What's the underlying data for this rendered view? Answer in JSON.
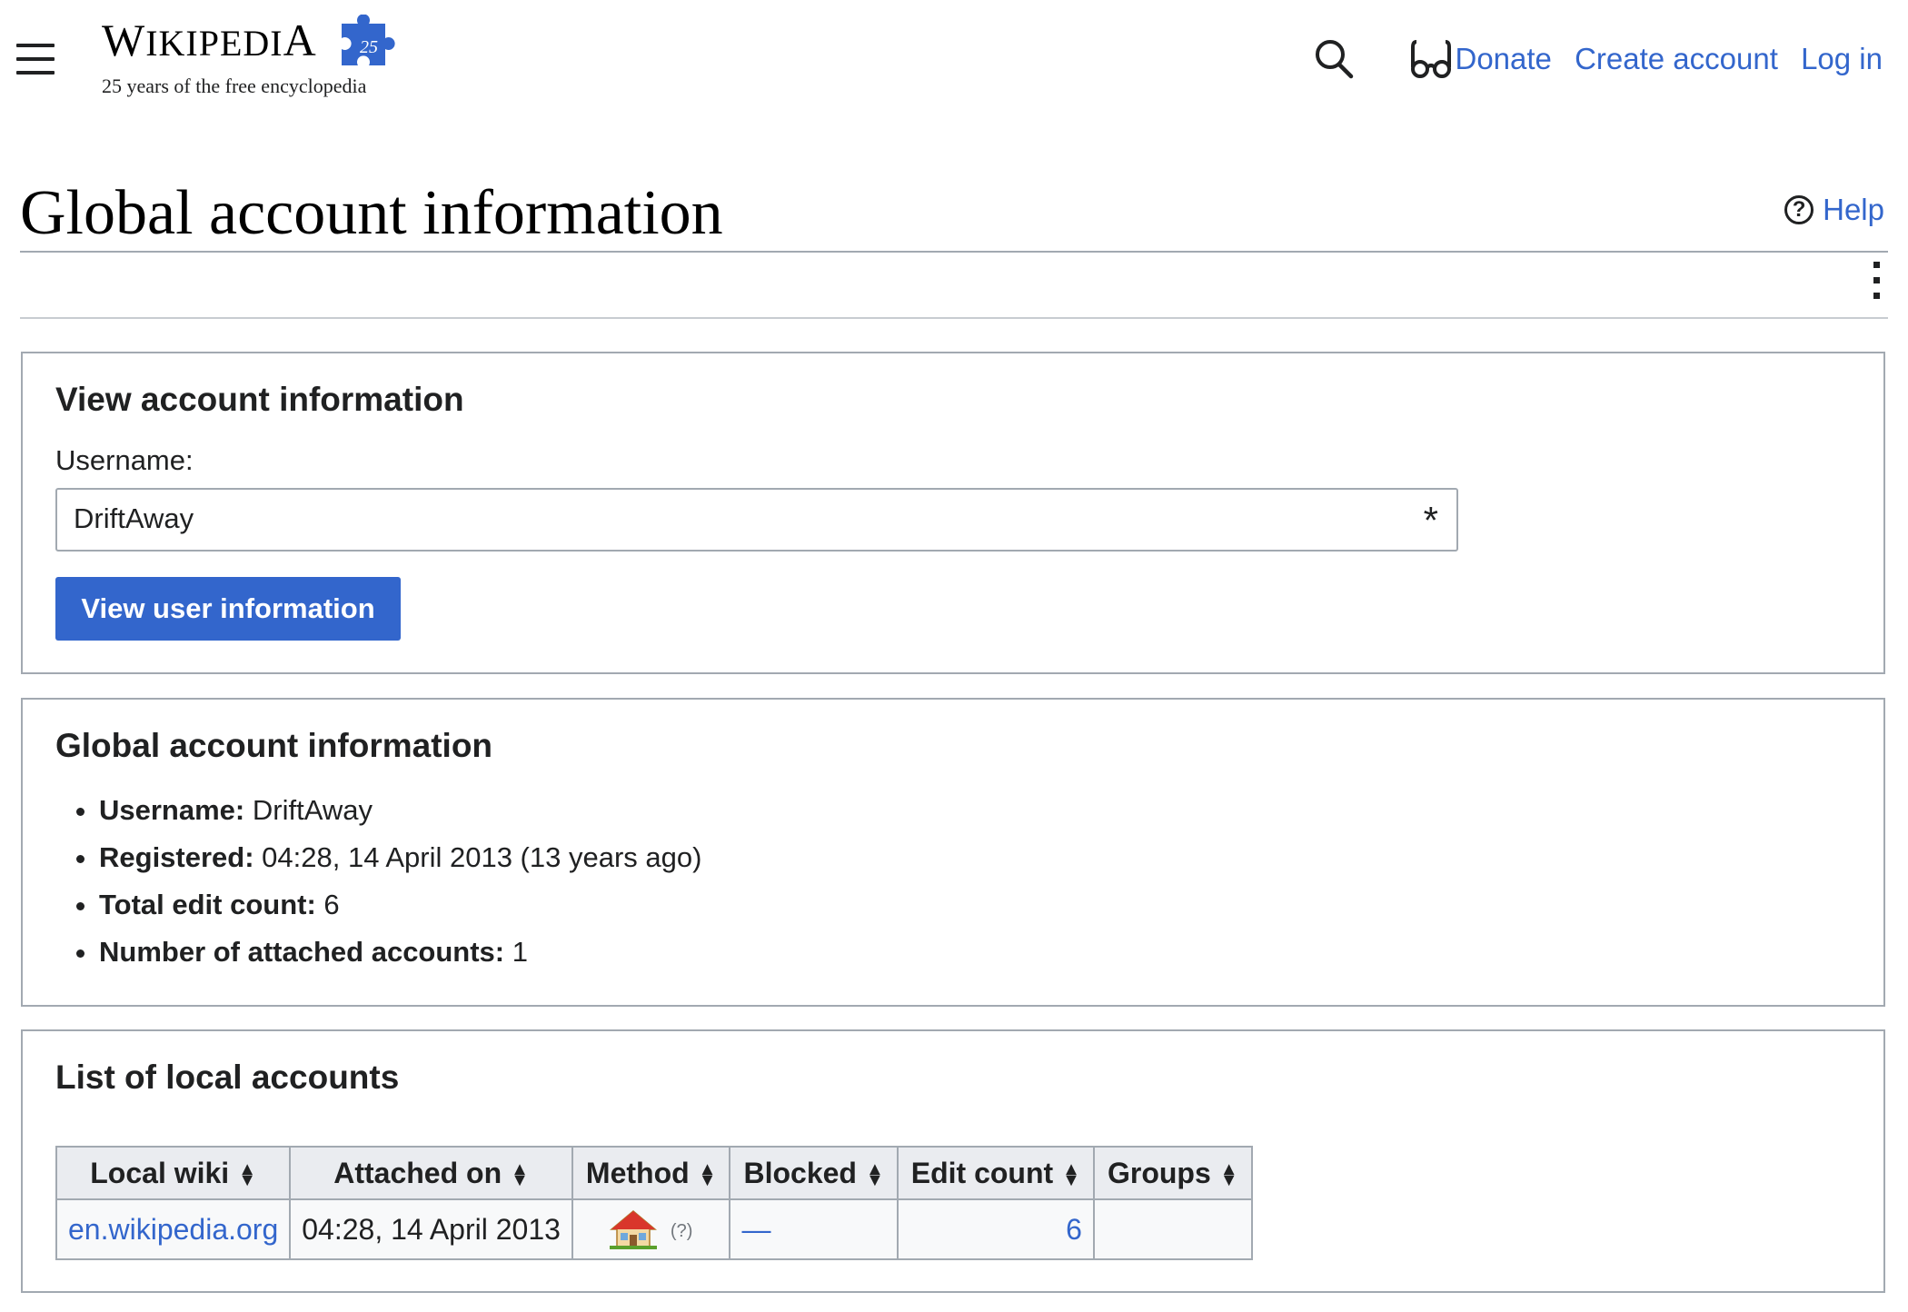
{
  "header": {
    "wordmark_first": "W",
    "wordmark_rest": "IKIPEDI",
    "wordmark_last": "A",
    "anniversary_badge": "25",
    "tagline": "25 years of the free encyclopedia",
    "links": {
      "donate": "Donate",
      "create_account": "Create account",
      "log_in": "Log in"
    }
  },
  "page": {
    "title": "Global account information",
    "help": "Help",
    "help_glyph": "?"
  },
  "view_form": {
    "heading": "View account information",
    "username_label": "Username:",
    "username_value": "DriftAway",
    "required_mark": "*",
    "submit_label": "View user information"
  },
  "global_info": {
    "heading": "Global account information",
    "items": [
      {
        "label": "Username:",
        "value": "DriftAway"
      },
      {
        "label": "Registered:",
        "value": "04:28, 14 April 2013 (13 years ago)"
      },
      {
        "label": "Total edit count:",
        "value": "6"
      },
      {
        "label": "Number of attached accounts:",
        "value": "1"
      }
    ]
  },
  "local_accounts": {
    "heading": "List of local accounts",
    "columns": [
      "Local wiki",
      "Attached on",
      "Method",
      "Blocked",
      "Edit count",
      "Groups"
    ],
    "rows": [
      {
        "local_wiki": "en.wikipedia.org",
        "attached_on": "04:28, 14 April 2013",
        "method_icon": "home-icon",
        "method_hint": "(?)",
        "blocked": "—",
        "edit_count": "6",
        "groups": ""
      }
    ]
  },
  "colors": {
    "link": "#3366cc",
    "button": "#3366cc",
    "border": "#a2a9b1",
    "header_bg": "#eaecf0"
  }
}
